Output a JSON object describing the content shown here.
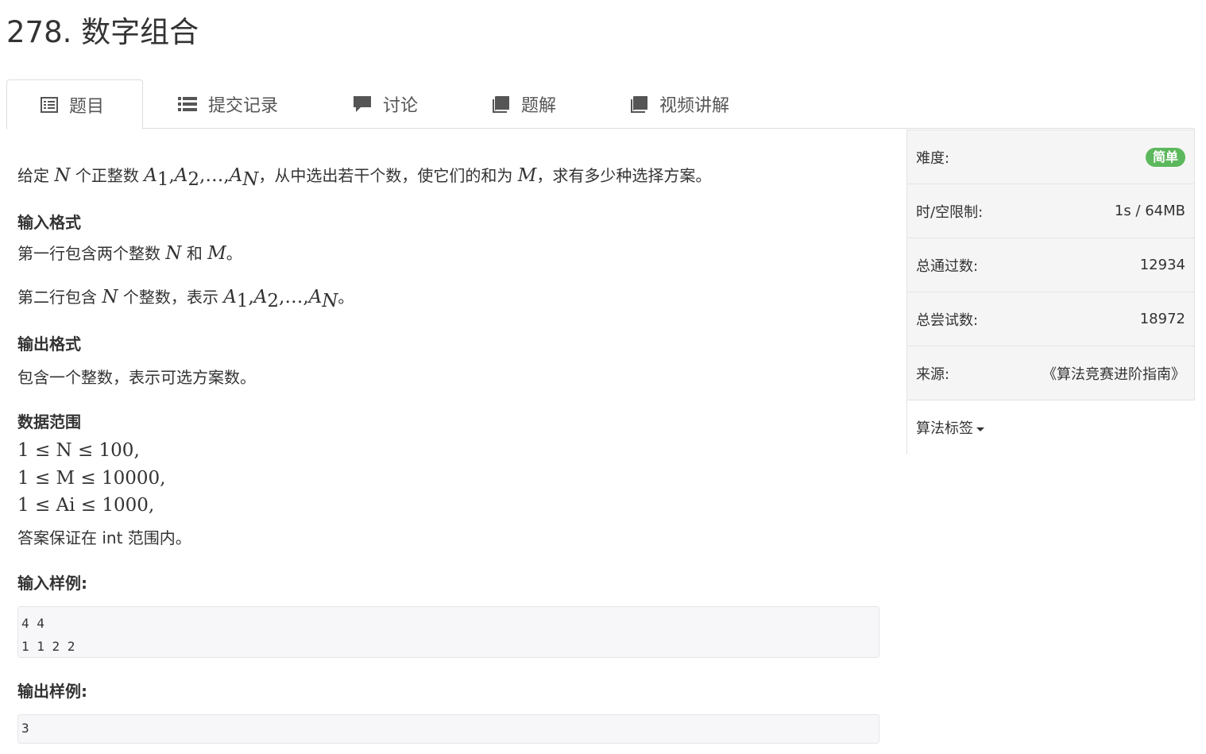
{
  "problem": {
    "title": "278. 数字组合"
  },
  "tabs": [
    {
      "label": "题目",
      "icon": "list-alt-icon"
    },
    {
      "label": "提交记录",
      "icon": "list-icon"
    },
    {
      "label": "讨论",
      "icon": "comment-icon"
    },
    {
      "label": "题解",
      "icon": "book-icon"
    },
    {
      "label": "视频讲解",
      "icon": "book-icon"
    }
  ],
  "statement": {
    "intro_a": "给定 ",
    "intro_b": " 个正整数 ",
    "intro_c": "，从中选出若干个数，使它们的和为 ",
    "intro_d": "，求有多少种选择方案。",
    "input_title": "输入格式",
    "input_line1_a": "第一行包含两个整数 ",
    "input_line1_b": " 和 ",
    "input_line1_c": "。",
    "input_line2_a": "第二行包含 ",
    "input_line2_b": " 个整数，表示 ",
    "input_line2_c": "。",
    "output_title": "输出格式",
    "output_text": "包含一个整数，表示可选方案数。",
    "range_title": "数据范围",
    "range_lines": [
      "1 ≤ N ≤ 100,",
      "1 ≤ M ≤ 10000,",
      "1 ≤ Ai ≤ 1000,"
    ],
    "range_note": "答案保证在 int 范围内。",
    "sample_input_title": "输入样例:",
    "sample_input": "4 4\n1 1 2 2",
    "sample_output_title": "输出样例:",
    "sample_output": "3"
  },
  "math": {
    "N": "N",
    "M": "M",
    "A": "A",
    "i": "i",
    "sub1": "1",
    "sub2": "2",
    "subN": "N",
    "comma": ",",
    "dots": "…",
    "le": "≤",
    "n100": "100,",
    "n10000": "10000,",
    "n1000": "1000,",
    "one": "1"
  },
  "info": {
    "difficulty_label": "难度:",
    "difficulty_value": "简单",
    "limit_label": "时/空限制:",
    "limit_value": "1s / 64MB",
    "passed_label": "总通过数:",
    "passed_value": "12934",
    "tried_label": "总尝试数:",
    "tried_value": "18972",
    "source_label": "来源:",
    "source_value": "《算法竞赛进阶指南》",
    "tags_label": "算法标签"
  },
  "colors": {
    "badge": "#5cb85c",
    "border": "#dddddd",
    "panel_bg": "#f5f5f5"
  }
}
